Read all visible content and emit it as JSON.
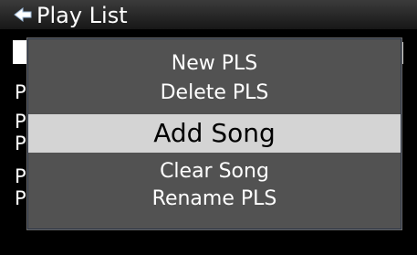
{
  "window": {
    "title": "Play List",
    "title_icon": "music-note-icon"
  },
  "list": {
    "items": [
      {
        "label": ""
      },
      {
        "label": "P"
      },
      {
        "label": "P"
      },
      {
        "label": "P"
      },
      {
        "label": "P"
      },
      {
        "label": "P"
      }
    ]
  },
  "popup_menu": {
    "items": [
      {
        "label": "New PLS"
      },
      {
        "label": "Delete PLS"
      },
      {
        "label": "Add Song"
      },
      {
        "label": "Clear Song"
      },
      {
        "label": "Rename PLS"
      }
    ],
    "selected_index": 2
  },
  "colors": {
    "background": "#000000",
    "popup": "#525252",
    "highlight": "#d4d4d4"
  }
}
